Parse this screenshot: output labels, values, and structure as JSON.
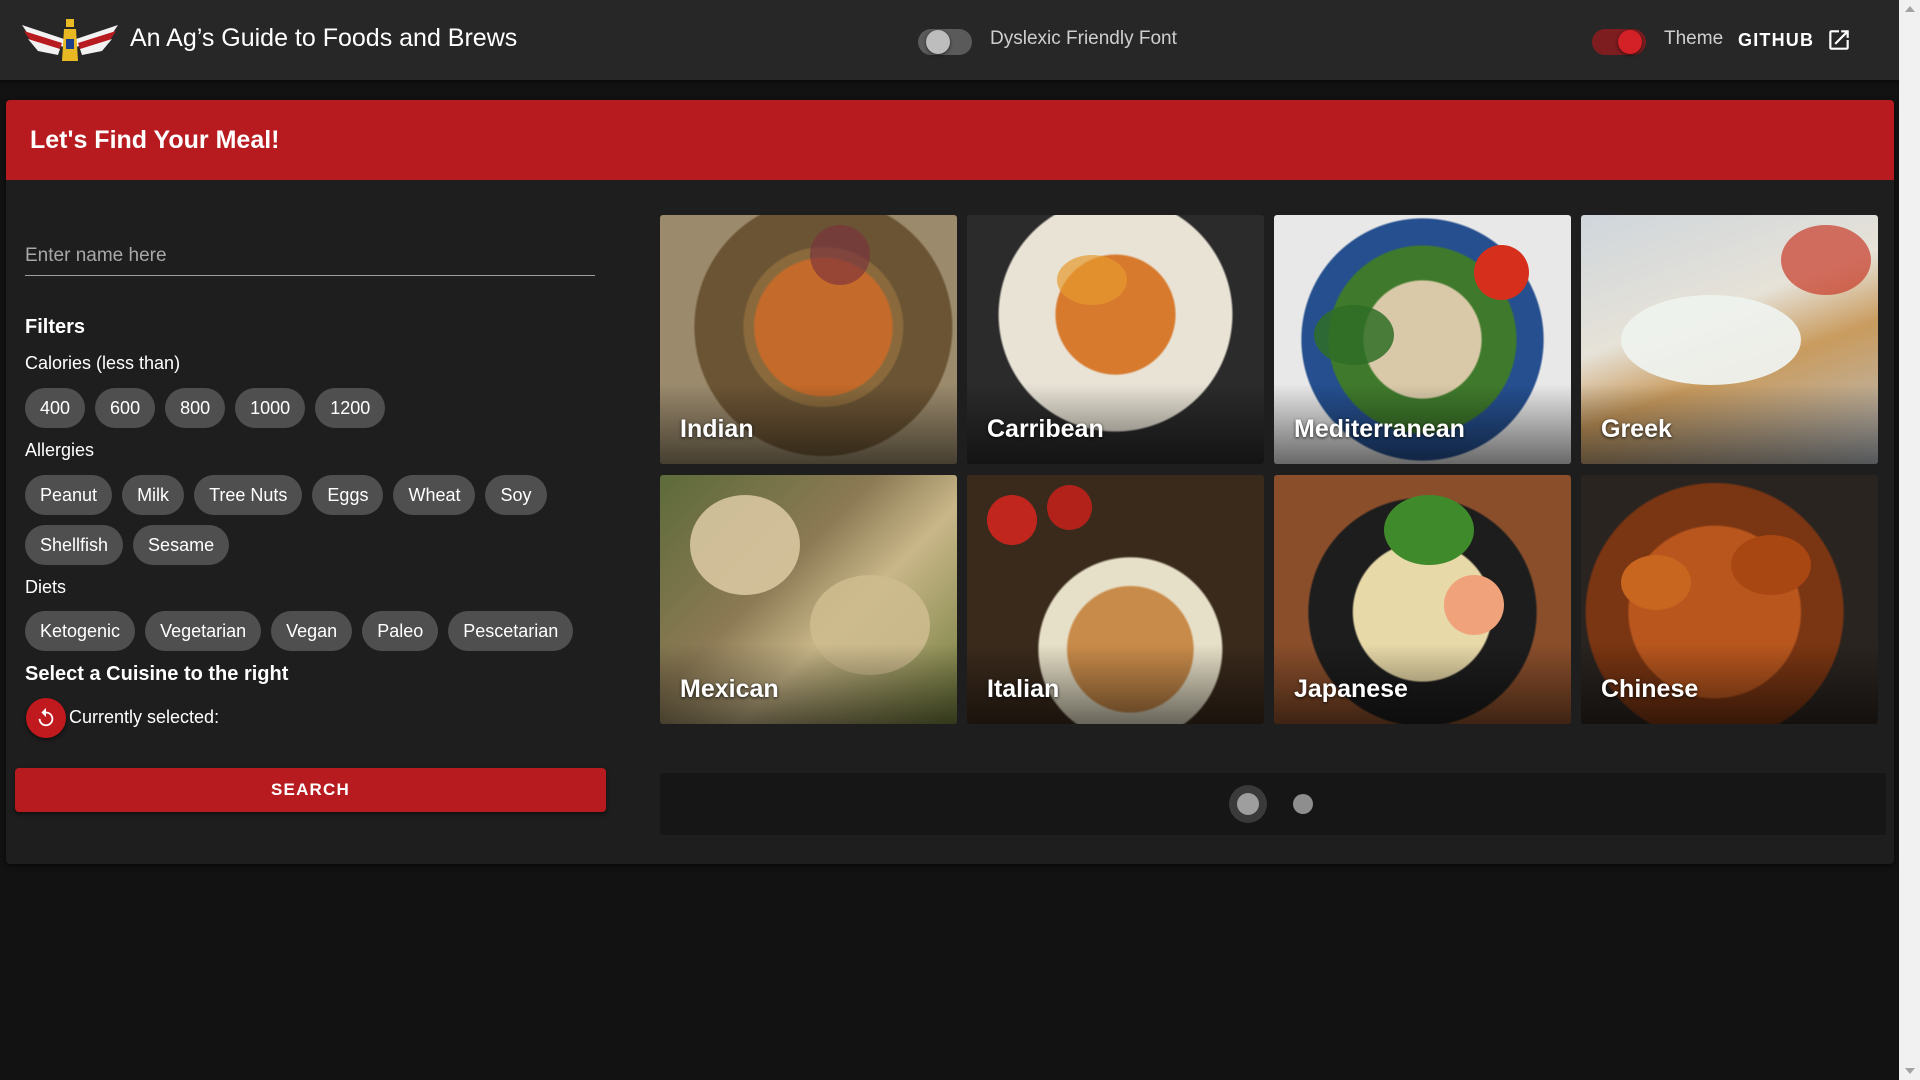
{
  "appbar": {
    "title": "An Ag’s Guide to Foods and Brews",
    "dyslexic_label": "Dyslexic Friendly Font",
    "dyslexic_on": false,
    "theme_label": "Theme",
    "theme_on": true,
    "github_label": "GITHUB"
  },
  "main": {
    "heading": "Let's Find Your Meal!",
    "name_placeholder": "Enter name here",
    "filters_title": "Filters",
    "calories_label": "Calories (less than)",
    "calories": [
      "400",
      "600",
      "800",
      "1000",
      "1200"
    ],
    "allergies_label": "Allergies",
    "allergies_row1": [
      "Peanut",
      "Milk",
      "Tree Nuts",
      "Eggs",
      "Wheat",
      "Soy"
    ],
    "allergies_row2": [
      "Shellfish",
      "Sesame"
    ],
    "diets_label": "Diets",
    "diets": [
      "Ketogenic",
      "Vegetarian",
      "Vegan",
      "Paleo",
      "Pescetarian"
    ],
    "cuisine_prompt": "Select a Cuisine to the right",
    "currently_selected_label": "Currently selected:",
    "search_label": "SEARCH"
  },
  "cuisines": [
    {
      "name": "Indian"
    },
    {
      "name": "Carribean"
    },
    {
      "name": "Mediterranean"
    },
    {
      "name": "Greek"
    },
    {
      "name": "Mexican"
    },
    {
      "name": "Italian"
    },
    {
      "name": "Japanese"
    },
    {
      "name": "Chinese"
    }
  ],
  "pagination": {
    "pages": 2,
    "current": 1
  },
  "colors": {
    "primary": "#b71b1f",
    "appbar": "#272727",
    "surface": "#1e1e1e",
    "background": "#121212",
    "chip": "#4f4f4f"
  }
}
